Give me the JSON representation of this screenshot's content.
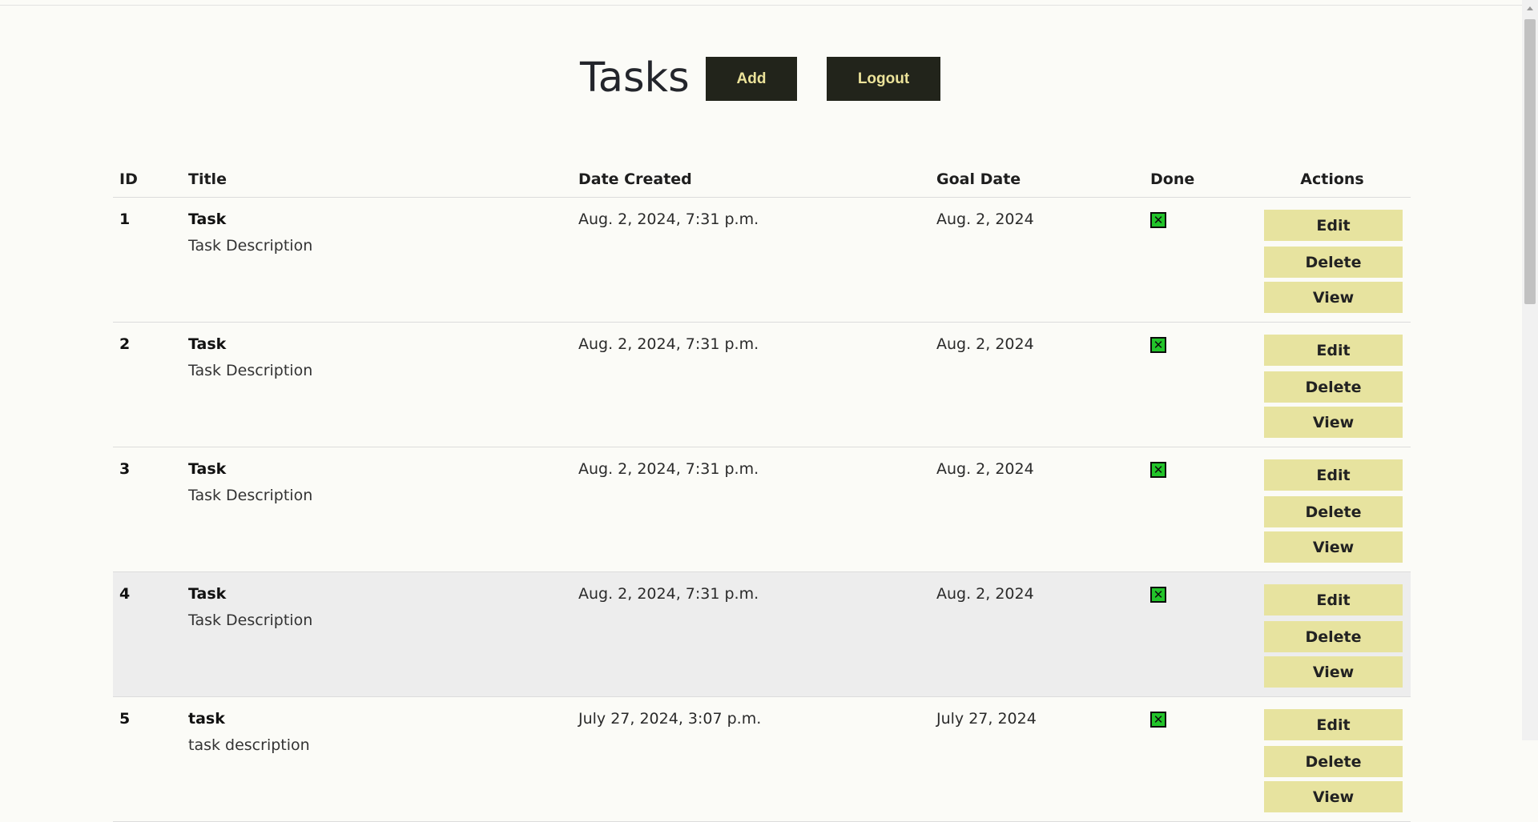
{
  "header": {
    "title": "Tasks",
    "add_label": "Add",
    "logout_label": "Logout"
  },
  "table": {
    "columns": [
      "ID",
      "Title",
      "Date Created",
      "Goal Date",
      "Done",
      "Actions"
    ],
    "rows": [
      {
        "id": "1",
        "title": "Task",
        "description": "Task Description",
        "date_created": "Aug. 2, 2024, 7:31 p.m.",
        "goal_date": "Aug. 2, 2024",
        "done": "✕"
      },
      {
        "id": "2",
        "title": "Task",
        "description": "Task Description",
        "date_created": "Aug. 2, 2024, 7:31 p.m.",
        "goal_date": "Aug. 2, 2024",
        "done": "✕"
      },
      {
        "id": "3",
        "title": "Task",
        "description": "Task Description",
        "date_created": "Aug. 2, 2024, 7:31 p.m.",
        "goal_date": "Aug. 2, 2024",
        "done": "✕"
      },
      {
        "id": "4",
        "title": "Task",
        "description": "Task Description",
        "date_created": "Aug. 2, 2024, 7:31 p.m.",
        "goal_date": "Aug. 2, 2024",
        "done": "✕"
      },
      {
        "id": "5",
        "title": "task",
        "description": "task description",
        "date_created": "July 27, 2024, 3:07 p.m.",
        "goal_date": "July 27, 2024",
        "done": "✕"
      }
    ],
    "actions": {
      "edit_label": "Edit",
      "delete_label": "Delete",
      "view_label": "View"
    }
  },
  "colors": {
    "background": "#fbfbf7",
    "header_button_bg": "#22241b",
    "header_button_text": "#ece39a",
    "action_button_bg": "#e7e39f",
    "done_icon": "#22c42a",
    "row_highlight": "#ededed"
  },
  "icons": {
    "done": "checkbox-x-icon"
  }
}
